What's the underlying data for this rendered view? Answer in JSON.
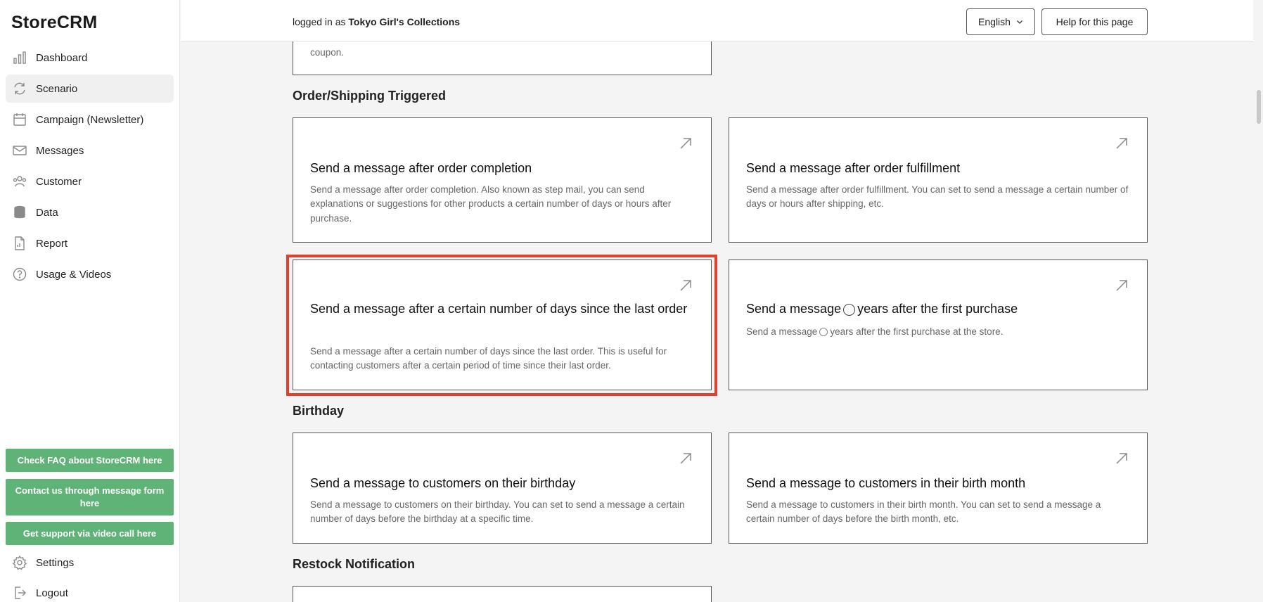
{
  "app": {
    "logo": "StoreCRM"
  },
  "sidebar": {
    "items": [
      {
        "label": "Dashboard",
        "icon": "bar-chart-icon"
      },
      {
        "label": "Scenario",
        "icon": "refresh-icon"
      },
      {
        "label": "Campaign (Newsletter)",
        "icon": "calendar-icon"
      },
      {
        "label": "Messages",
        "icon": "mail-icon"
      },
      {
        "label": "Customer",
        "icon": "users-icon"
      },
      {
        "label": "Data",
        "icon": "database-icon"
      },
      {
        "label": "Report",
        "icon": "document-icon"
      },
      {
        "label": "Usage & Videos",
        "icon": "help-circle-icon"
      }
    ],
    "active_index": 1,
    "support_buttons": [
      "Check FAQ about StoreCRM here",
      "Contact us through message form here",
      "Get support via video call here"
    ],
    "bottom_items": [
      {
        "label": "Settings",
        "icon": "gear-icon"
      },
      {
        "label": "Logout",
        "icon": "logout-icon"
      }
    ],
    "accent_color": "#5fb376"
  },
  "topbar": {
    "login_prefix": "logged in as",
    "store_name": "Tokyo Girl's Collections",
    "language": "English",
    "help_label": "Help for this page"
  },
  "main": {
    "partial_card_text": "coupon.",
    "sections": [
      {
        "title": "Order/Shipping Triggered",
        "cards": [
          {
            "title": "Send a message after order completion",
            "desc": "Send a message after order completion. Also known as step mail, you can send explanations or suggestions for other products a certain number of days or hours after purchase."
          },
          {
            "title": "Send a message after order fulfillment",
            "desc": "Send a message after order fulfillment. You can set to send a message a certain number of days or hours after shipping, etc."
          },
          {
            "title": "Send a message after a certain number of days since the last order",
            "desc": "Send a message after a certain number of days since the last order. This is useful for contacting customers after a certain period of time since their last order."
          },
          {
            "title_prefix": "Send a message",
            "title_suffix": "years after the first purchase",
            "desc_prefix": "Send a message",
            "desc_suffix": "years after the first purchase at the store."
          }
        ]
      },
      {
        "title": "Birthday",
        "cards": [
          {
            "title": "Send a message to customers on their birthday",
            "desc": "Send a message to customers on their birthday. You can set to send a message a certain number of days before the birthday at a specific time."
          },
          {
            "title": "Send a message to customers in their birth month",
            "desc": "Send a message to customers in their birth month. You can set to send a message a certain number of days before the birth month, etc."
          }
        ]
      },
      {
        "title": "Restock Notification",
        "cards": []
      }
    ],
    "highlight_color": "#e0402d"
  }
}
